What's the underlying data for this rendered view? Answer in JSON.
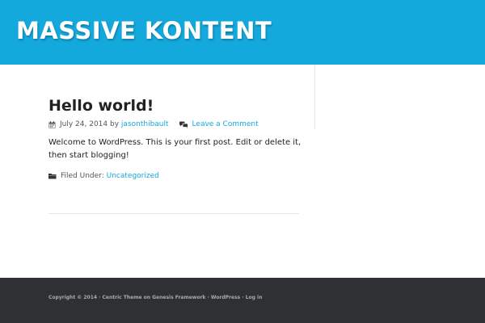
{
  "site": {
    "title": "MASSIVE KONTENT"
  },
  "post": {
    "title": "Hello world!",
    "date": "July 24, 2014",
    "by": "by",
    "author": "jasonthibault",
    "comment_link": "Leave a Comment",
    "content": "Welcome to WordPress. This is your first post. Edit or delete it, then start blogging!",
    "filed_under_label": "Filed Under:",
    "category": "Uncategorized"
  },
  "footer": {
    "copyright": "Copyright © 2014 · ",
    "theme_link": "Centric Theme",
    "on": " on ",
    "framework_link": "Genesis Framework",
    "sep1": " · ",
    "wordpress_link": "WordPress",
    "sep2": " · ",
    "login_link": "Log in"
  },
  "colors": {
    "header_bg": "#14a9dd",
    "link": "#14a9dd",
    "footer_bg": "#2f3033"
  },
  "icons": {
    "date": "calendar-icon",
    "comments": "comments-icon",
    "category": "folder-icon"
  }
}
